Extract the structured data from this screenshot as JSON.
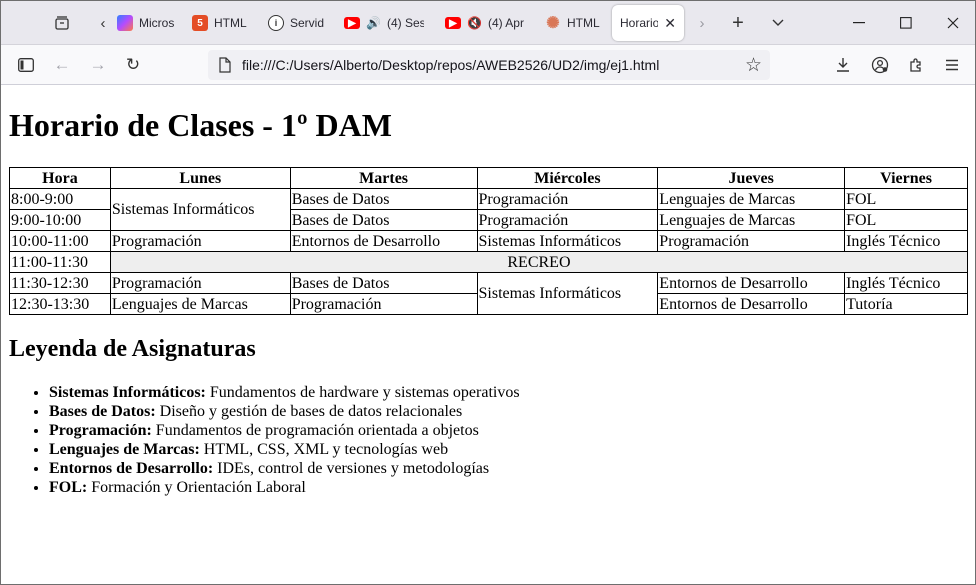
{
  "browser": {
    "tabs": [
      {
        "title": "Micros",
        "icon": "copilot-icon",
        "color": "#7b5cff"
      },
      {
        "title": "HTML",
        "icon": "html5-icon",
        "color": "#e44d26"
      },
      {
        "title": "Servid",
        "icon": "info-icon",
        "color": "#333333"
      },
      {
        "title": "(4) Ses",
        "icon": "youtube-icon",
        "color": "#ff0000",
        "sound": "playing"
      },
      {
        "title": "(4) Apr",
        "icon": "youtube-icon",
        "color": "#ff0000",
        "sound": "muted"
      },
      {
        "title": "HTML",
        "icon": "claude-icon",
        "color": "#d97757"
      },
      {
        "title": "Horario",
        "icon": "",
        "active": true
      }
    ],
    "url": "file:///C:/Users/Alberto/Desktop/repos/AWEB2526/UD2/img/ej1.html"
  },
  "page": {
    "title": "Horario de Clases - 1º DAM",
    "table": {
      "headers": [
        "Hora",
        "Lunes",
        "Martes",
        "Miércoles",
        "Jueves",
        "Viernes"
      ],
      "rows": [
        [
          "8:00-9:00",
          "Sistemas Informáticos",
          "Bases de Datos",
          "Programación",
          "Lenguajes de Marcas",
          "FOL"
        ],
        [
          "9:00-10:00",
          "Bases de Datos",
          "Programación",
          "Lenguajes de Marcas",
          "FOL"
        ],
        [
          "10:00-11:00",
          "Programación",
          "Entornos de Desarrollo",
          "Sistemas Informáticos",
          "Programación",
          "Inglés Técnico"
        ],
        [
          "11:00-11:30",
          "RECREO"
        ],
        [
          "11:30-12:30",
          "Programación",
          "Bases de Datos",
          "Sistemas Informáticos",
          "Entornos de Desarrollo",
          "Inglés Técnico"
        ],
        [
          "12:30-13:30",
          "Lenguajes de Marcas",
          "Programación",
          "Entornos de Desarrollo",
          "Tutoría"
        ]
      ]
    },
    "legend_title": "Leyenda de Asignaturas",
    "legend": [
      {
        "term": "Sistemas Informáticos:",
        "desc": " Fundamentos de hardware y sistemas operativos"
      },
      {
        "term": "Bases de Datos:",
        "desc": " Diseño y gestión de bases de datos relacionales"
      },
      {
        "term": "Programación:",
        "desc": " Fundamentos de programación orientada a objetos"
      },
      {
        "term": "Lenguajes de Marcas:",
        "desc": " HTML, CSS, XML y tecnologías web"
      },
      {
        "term": "Entornos de Desarrollo:",
        "desc": " IDEs, control de versiones y metodologías"
      },
      {
        "term": "FOL:",
        "desc": " Formación y Orientación Laboral"
      }
    ]
  }
}
